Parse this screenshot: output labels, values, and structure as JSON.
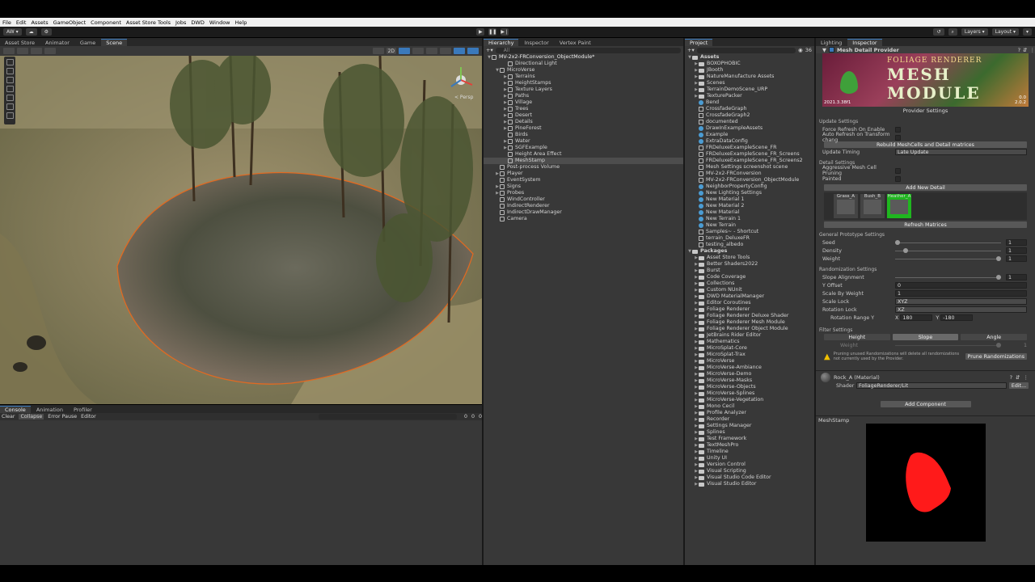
{
  "menu": [
    "File",
    "Edit",
    "Assets",
    "GameObject",
    "Component",
    "Asset Store Tools",
    "Jobs",
    "DWD",
    "Window",
    "Help"
  ],
  "toolbar": {
    "account": "AW",
    "layers": "Layers",
    "layout": "Layout"
  },
  "scene_tabs": [
    "Asset Store",
    "Animator",
    "Game",
    "Scene"
  ],
  "scene_view": {
    "mode": "2D",
    "persp": "< Persp"
  },
  "console": {
    "tabs": [
      "Console",
      "Animation",
      "Profiler"
    ],
    "clear": "Clear",
    "collapse": "Collapse",
    "error_pause": "Error Pause",
    "editor": "Editor",
    "counts": [
      "0",
      "0",
      "0"
    ]
  },
  "hierarchy": {
    "tabs": [
      "Hierarchy",
      "Inspector",
      "Vertex Paint"
    ],
    "search_placeholder": "All",
    "rows": [
      {
        "label": "MV-2x2-FRConversion_ObjectModule*",
        "indent": 0,
        "fold": "▼",
        "kind": "scene"
      },
      {
        "label": "Directional Light",
        "indent": 2,
        "fold": "",
        "kind": "go"
      },
      {
        "label": "MicroVerse",
        "indent": 1,
        "fold": "▼",
        "kind": "go"
      },
      {
        "label": "Terrains",
        "indent": 2,
        "fold": "▶",
        "kind": "go"
      },
      {
        "label": "HeightStamps",
        "indent": 2,
        "fold": "▶",
        "kind": "go"
      },
      {
        "label": "Texture Layers",
        "indent": 2,
        "fold": "▶",
        "kind": "go"
      },
      {
        "label": "Paths",
        "indent": 2,
        "fold": "▶",
        "kind": "go"
      },
      {
        "label": "Village",
        "indent": 2,
        "fold": "▶",
        "kind": "go"
      },
      {
        "label": "Trees",
        "indent": 2,
        "fold": "▶",
        "kind": "go"
      },
      {
        "label": "Desert",
        "indent": 2,
        "fold": "▶",
        "kind": "go"
      },
      {
        "label": "Details",
        "indent": 2,
        "fold": "▶",
        "kind": "go"
      },
      {
        "label": "PineForest",
        "indent": 2,
        "fold": "▶",
        "kind": "go"
      },
      {
        "label": "Birds",
        "indent": 2,
        "fold": "",
        "kind": "go"
      },
      {
        "label": "Water",
        "indent": 2,
        "fold": "▶",
        "kind": "go"
      },
      {
        "label": "SGFExample",
        "indent": 2,
        "fold": "▶",
        "kind": "go"
      },
      {
        "label": "Height Area Effect",
        "indent": 2,
        "fold": "",
        "kind": "go"
      },
      {
        "label": "MeshStamp",
        "indent": 2,
        "fold": "",
        "kind": "go",
        "selected": true
      },
      {
        "label": "Post-process Volume",
        "indent": 1,
        "fold": "",
        "kind": "go"
      },
      {
        "label": "Player",
        "indent": 1,
        "fold": "▶",
        "kind": "go"
      },
      {
        "label": "EventSystem",
        "indent": 1,
        "fold": "",
        "kind": "go"
      },
      {
        "label": "Signs",
        "indent": 1,
        "fold": "▶",
        "kind": "go"
      },
      {
        "label": "Probes",
        "indent": 1,
        "fold": "▶",
        "kind": "go"
      },
      {
        "label": "WindController",
        "indent": 1,
        "fold": "",
        "kind": "go"
      },
      {
        "label": "IndirectRenderer",
        "indent": 1,
        "fold": "",
        "kind": "go"
      },
      {
        "label": "IndirectDrawManager",
        "indent": 1,
        "fold": "",
        "kind": "go"
      },
      {
        "label": "Camera",
        "indent": 1,
        "fold": "",
        "kind": "go"
      }
    ]
  },
  "project": {
    "tab": "Project",
    "badge": "36",
    "rows": [
      {
        "label": "Assets",
        "indent": 0,
        "kind": "folder",
        "fold": "▼",
        "bold": true
      },
      {
        "label": "BOXOPHOBIC",
        "indent": 1,
        "kind": "folder",
        "fold": "▶"
      },
      {
        "label": "JBooth",
        "indent": 1,
        "kind": "folder",
        "fold": "▶"
      },
      {
        "label": "NatureManufacture Assets",
        "indent": 1,
        "kind": "folder",
        "fold": "▶"
      },
      {
        "label": "Scenes",
        "indent": 1,
        "kind": "folder",
        "fold": "▶"
      },
      {
        "label": "TerrainDemoScene_URP",
        "indent": 1,
        "kind": "folder",
        "fold": "▶"
      },
      {
        "label": "TexturePacker",
        "indent": 1,
        "kind": "folder",
        "fold": "▶"
      },
      {
        "label": "Bend",
        "indent": 1,
        "kind": "asset",
        "fold": ""
      },
      {
        "label": "CrossfadeGraph",
        "indent": 1,
        "kind": "file",
        "fold": ""
      },
      {
        "label": "CrossfadeGraph2",
        "indent": 1,
        "kind": "file",
        "fold": ""
      },
      {
        "label": "documented",
        "indent": 1,
        "kind": "file",
        "fold": ""
      },
      {
        "label": "DrawInExampleAssets",
        "indent": 1,
        "kind": "asset",
        "fold": ""
      },
      {
        "label": "Example",
        "indent": 1,
        "kind": "asset",
        "fold": ""
      },
      {
        "label": "ExtraDataConfig",
        "indent": 1,
        "kind": "asset",
        "fold": ""
      },
      {
        "label": "FRDeluxeExampleScene_FR",
        "indent": 1,
        "kind": "unity",
        "fold": ""
      },
      {
        "label": "FRDeluxeExampleScene_FR_Screens",
        "indent": 1,
        "kind": "unity",
        "fold": ""
      },
      {
        "label": "FRDeluxeExampleScene_FR_Screens2",
        "indent": 1,
        "kind": "unity",
        "fold": ""
      },
      {
        "label": "Mesh Settings screenshot scene",
        "indent": 1,
        "kind": "unity",
        "fold": ""
      },
      {
        "label": "MV-2x2-FRConversion",
        "indent": 1,
        "kind": "unity",
        "fold": ""
      },
      {
        "label": "MV-2x2-FRConversion_ObjectModule",
        "indent": 1,
        "kind": "unity",
        "fold": ""
      },
      {
        "label": "NeighborPropertyConfig",
        "indent": 1,
        "kind": "asset",
        "fold": ""
      },
      {
        "label": "New Lighting Settings",
        "indent": 1,
        "kind": "asset",
        "fold": ""
      },
      {
        "label": "New Material 1",
        "indent": 1,
        "kind": "asset",
        "fold": ""
      },
      {
        "label": "New Material 2",
        "indent": 1,
        "kind": "asset",
        "fold": ""
      },
      {
        "label": "New Material",
        "indent": 1,
        "kind": "asset",
        "fold": ""
      },
      {
        "label": "New Terrain 1",
        "indent": 1,
        "kind": "asset",
        "fold": ""
      },
      {
        "label": "New Terrain",
        "indent": 1,
        "kind": "asset",
        "fold": ""
      },
      {
        "label": "Samples~ - Shortcut",
        "indent": 1,
        "kind": "file",
        "fold": ""
      },
      {
        "label": "terrain_DeluxeFR",
        "indent": 1,
        "kind": "file",
        "fold": ""
      },
      {
        "label": "testing_albedo",
        "indent": 1,
        "kind": "file",
        "fold": ""
      },
      {
        "label": "Packages",
        "indent": 0,
        "kind": "folder",
        "fold": "▼",
        "bold": true
      },
      {
        "label": "Asset Store Tools",
        "indent": 1,
        "kind": "folder",
        "fold": "▶"
      },
      {
        "label": "Better Shaders2022",
        "indent": 1,
        "kind": "folder",
        "fold": "▶"
      },
      {
        "label": "Burst",
        "indent": 1,
        "kind": "folder",
        "fold": "▶"
      },
      {
        "label": "Code Coverage",
        "indent": 1,
        "kind": "folder",
        "fold": "▶"
      },
      {
        "label": "Collections",
        "indent": 1,
        "kind": "folder",
        "fold": "▶"
      },
      {
        "label": "Custom NUnit",
        "indent": 1,
        "kind": "folder",
        "fold": "▶"
      },
      {
        "label": "DWD MaterialManager",
        "indent": 1,
        "kind": "folder",
        "fold": "▶"
      },
      {
        "label": "Editor Coroutines",
        "indent": 1,
        "kind": "folder",
        "fold": "▶"
      },
      {
        "label": "Foliage Renderer",
        "indent": 1,
        "kind": "folder",
        "fold": "▶"
      },
      {
        "label": "Foliage Renderer Deluxe Shader",
        "indent": 1,
        "kind": "folder",
        "fold": "▶"
      },
      {
        "label": "Foliage Renderer Mesh Module",
        "indent": 1,
        "kind": "folder",
        "fold": "▶"
      },
      {
        "label": "Foliage Renderer Object Module",
        "indent": 1,
        "kind": "folder",
        "fold": "▶"
      },
      {
        "label": "JetBrains Rider Editor",
        "indent": 1,
        "kind": "folder",
        "fold": "▶"
      },
      {
        "label": "Mathematics",
        "indent": 1,
        "kind": "folder",
        "fold": "▶"
      },
      {
        "label": "MicroSplat-Core",
        "indent": 1,
        "kind": "folder",
        "fold": "▶"
      },
      {
        "label": "MicroSplat-Trax",
        "indent": 1,
        "kind": "folder",
        "fold": "▶"
      },
      {
        "label": "MicroVerse",
        "indent": 1,
        "kind": "folder",
        "fold": "▶"
      },
      {
        "label": "MicroVerse-Ambiance",
        "indent": 1,
        "kind": "folder",
        "fold": "▶"
      },
      {
        "label": "MicroVerse-Demo",
        "indent": 1,
        "kind": "folder",
        "fold": "▶"
      },
      {
        "label": "MicroVerse-Masks",
        "indent": 1,
        "kind": "folder",
        "fold": "▶"
      },
      {
        "label": "MicroVerse-Objects",
        "indent": 1,
        "kind": "folder",
        "fold": "▶"
      },
      {
        "label": "MicroVerse-Splines",
        "indent": 1,
        "kind": "folder",
        "fold": "▶"
      },
      {
        "label": "MicroVerse-Vegetation",
        "indent": 1,
        "kind": "folder",
        "fold": "▶"
      },
      {
        "label": "Mono Cecil",
        "indent": 1,
        "kind": "folder",
        "fold": "▶"
      },
      {
        "label": "Profile Analyzer",
        "indent": 1,
        "kind": "folder",
        "fold": "▶"
      },
      {
        "label": "Recorder",
        "indent": 1,
        "kind": "folder",
        "fold": "▶"
      },
      {
        "label": "Settings Manager",
        "indent": 1,
        "kind": "folder",
        "fold": "▶"
      },
      {
        "label": "Splines",
        "indent": 1,
        "kind": "folder",
        "fold": "▶"
      },
      {
        "label": "Test Framework",
        "indent": 1,
        "kind": "folder",
        "fold": "▶"
      },
      {
        "label": "TextMeshPro",
        "indent": 1,
        "kind": "folder",
        "fold": "▶"
      },
      {
        "label": "Timeline",
        "indent": 1,
        "kind": "folder",
        "fold": "▶"
      },
      {
        "label": "Unity UI",
        "indent": 1,
        "kind": "folder",
        "fold": "▶"
      },
      {
        "label": "Version Control",
        "indent": 1,
        "kind": "folder",
        "fold": "▶"
      },
      {
        "label": "Visual Scripting",
        "indent": 1,
        "kind": "folder",
        "fold": "▶"
      },
      {
        "label": "Visual Studio Code Editor",
        "indent": 1,
        "kind": "folder",
        "fold": "▶"
      },
      {
        "label": "Visual Studio Editor",
        "indent": 1,
        "kind": "folder",
        "fold": "▶"
      }
    ]
  },
  "inspector": {
    "tabs": [
      "Lighting",
      "Inspector"
    ],
    "component_title": "Mesh Detail Provider",
    "banner": {
      "brand": "FOLIAGE RENDERER",
      "line1": "MESH",
      "line2": "MODULE",
      "version_left": "2021.3.38f1",
      "version_right": "0.0\n2.0.2"
    },
    "provider_settings": "Provider Settings",
    "update_settings": "Update Settings",
    "force_refresh": "Force Refresh On Enable",
    "auto_refresh": "Auto Refresh on Transform chang",
    "rebuild_btn": "Rebuild MeshCells and Detail matrices",
    "update_timing_label": "Update Timing",
    "update_timing_value": "Late Update",
    "detail_settings": "Detail Settings",
    "aggressive": "Aggressive Mesh Cell Pruning",
    "painted": "Painted",
    "add_detail": "Add New Detail",
    "details": [
      {
        "name": "Grass_A",
        "selected": false
      },
      {
        "name": "Bush_B",
        "selected": false
      },
      {
        "name": "Heather_A",
        "selected": true
      }
    ],
    "refresh_matrices": "Refresh Matrices",
    "general_proto": "General Prototype Settings",
    "seed_label": "Seed",
    "seed_value": "1",
    "seed_level": 0.0,
    "density_label": "Density",
    "density_value": "1",
    "density_level": 0.08,
    "weight_label": "Weight",
    "weight_value": "1",
    "weight_level": 1.0,
    "random_settings": "Randomization Settings",
    "slope_label": "Slope Alignment",
    "slope_value": "1",
    "slope_level": 1.0,
    "yoffset_label": "Y Offset",
    "yoffset_value": "0",
    "scale_weight_label": "Scale By Weight",
    "scale_weight_value": "1",
    "scale_lock_label": "Scale Lock",
    "scale_lock_value": "XYZ",
    "rotation_lock_label": "Rotation Lock",
    "rotation_lock_value": "XZ",
    "rotation_range_label": "Rotation Range Y",
    "rot_x_label": "X",
    "rot_x_value": "180",
    "rot_y_label": "Y",
    "rot_y_value": "-180",
    "filter_settings": "Filter Settings",
    "filter_tabs": [
      "Height",
      "Slope",
      "Angle"
    ],
    "filter_weight_label": "Weight",
    "filter_weight_value": "1",
    "warning_text": "Pruning unused Randomizations will delete all randomizations not currently used by the Provider.",
    "prune_btn": "Prune Randomizations",
    "material_name": "Rock_A (Material)",
    "shader_label": "Shader",
    "shader_value": "FoliageRenderer/Lit",
    "edit_btn": "Edit...",
    "add_component": "Add Component",
    "preview_title": "MeshStamp"
  },
  "colors": {
    "accent": "#3a79bb",
    "selected_detail": "#1fb61f",
    "stamp": "#ff1a1a",
    "selection_outline": "#e06a22"
  }
}
